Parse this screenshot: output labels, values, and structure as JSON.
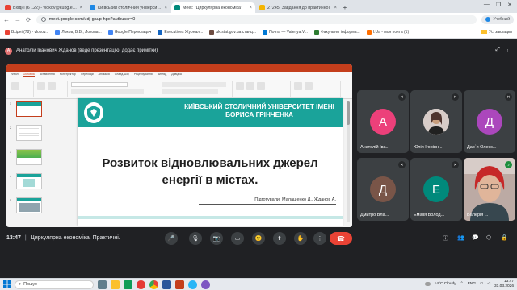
{
  "browser": {
    "tabs": [
      {
        "title": "Вхідні (6 122) - vlokov@kubg.edu",
        "favicon_color": "#ea4335",
        "active": false
      },
      {
        "title": "Київський столичний університет",
        "favicon_color": "#1e88e5",
        "active": false
      },
      {
        "title": "Meet: \"Циркулярна економіка\"",
        "favicon_color": "#00897b",
        "active": true
      },
      {
        "title": "27245: Завдання до практичної",
        "favicon_color": "#f4b400",
        "active": false
      }
    ],
    "new_tab_label": "+",
    "window_controls": [
      "—",
      "❐",
      "✕"
    ],
    "nav_back": "←",
    "nav_forward": "→",
    "nav_reload": "⟳",
    "address": "meet.google.com/udj-gaup-hpx?authuser=0",
    "profile_label": "Учебный",
    "bookmarks": [
      {
        "label": "Вхідні (78) - vlokov...",
        "color": "#ea4335"
      },
      {
        "label": "Локов, В.В., Локова...",
        "color": "#4285f4"
      },
      {
        "label": "Google Перекладач",
        "color": "#4285f4"
      },
      {
        "label": "Executives Журнал...",
        "color": "#1565c0"
      },
      {
        "label": "ukrstat.gov.ua станц...",
        "color": "#6d4c41"
      },
      {
        "label": "Почта — Valeriya.V...",
        "color": "#0078d4"
      },
      {
        "label": "Факультет інформа...",
        "color": "#2e7d32"
      },
      {
        "label": "I.Ua - моя почта (1)",
        "color": "#ff6f00"
      }
    ],
    "all_bookmarks_label": "Усі закладки"
  },
  "meet": {
    "presenter_initial": "А",
    "presenter_text": "Анатолій Іванович Жданов (веде презентацію, додає примітки)",
    "header_icons": [
      "⤢",
      "⋮"
    ],
    "slide": {
      "university": "КИЇВСЬКИЙ СТОЛИЧНИЙ УНІВЕРСИТЕТ ІМЕНІ БОРИСА ГРІНЧЕНКА",
      "title": "Розвиток відновлювальних джерел енергії в містах.",
      "authors": "Підготували: Малашенко Д., Жданов А."
    },
    "thumb_numbers": [
      "1",
      "2",
      "3",
      "4",
      "5"
    ],
    "ribbon_tabs": [
      "Файл",
      "Основна",
      "Вставлення",
      "Конструктор",
      "Переходи",
      "Анімація",
      "Слайд-шоу",
      "Рецензування",
      "Вигляд",
      "Довідка"
    ],
    "participants": [
      {
        "initial": "А",
        "name": "Анатолій Іва...",
        "color": "#ec407a"
      },
      {
        "initial": "",
        "name": "Юлія Ігорівн...",
        "color": "#6d4c41"
      },
      {
        "initial": "Д",
        "name": "Дар`я Олекс...",
        "color": "#ab47bc"
      },
      {
        "initial": "Д",
        "name": "Дмитро Вла...",
        "color": "#795548"
      },
      {
        "initial": "Е",
        "name": "Емілія Волод...",
        "color": "#00897b"
      },
      {
        "initial": "",
        "name": "Валерія ...",
        "color": "#8d6e63"
      }
    ],
    "time": "13:47",
    "meeting_name": "Циркулярна економіка. Практичні.",
    "controls": [
      "🎤",
      "📷",
      "▭",
      "🙂",
      "⬆",
      "✋",
      "⋮"
    ],
    "leave_icon": "☎",
    "right_controls": [
      "ⓘ",
      "👥",
      "💬",
      "⬡",
      "🔒"
    ]
  },
  "taskbar": {
    "search_label": "Пошук",
    "weather": "14°C Cloudy",
    "language": "ENG",
    "time": "13:47",
    "date": "31.03.2026"
  },
  "colors": {
    "meet_background": "#202124",
    "slide_accent": "#1aa39a",
    "ppt_accent": "#c43e1c",
    "leave_button": "#ea4335"
  }
}
